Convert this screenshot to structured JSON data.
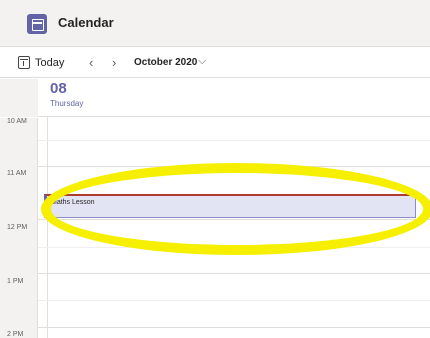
{
  "app": {
    "title": "Calendar",
    "icon": "calendar-icon",
    "accent": "#6264a7"
  },
  "toolbar": {
    "today_label": "Today",
    "prev_icon": "‹",
    "next_icon": "›",
    "month_label": "October 2020",
    "chevron_icon": "⌵"
  },
  "day": {
    "number": "08",
    "name": "Thursday"
  },
  "times": [
    "10 AM",
    "11 AM",
    "12 PM",
    "1 PM",
    "2 PM"
  ],
  "event": {
    "title": "Maths Lesson"
  },
  "highlight": {
    "color": "#f6f000"
  }
}
